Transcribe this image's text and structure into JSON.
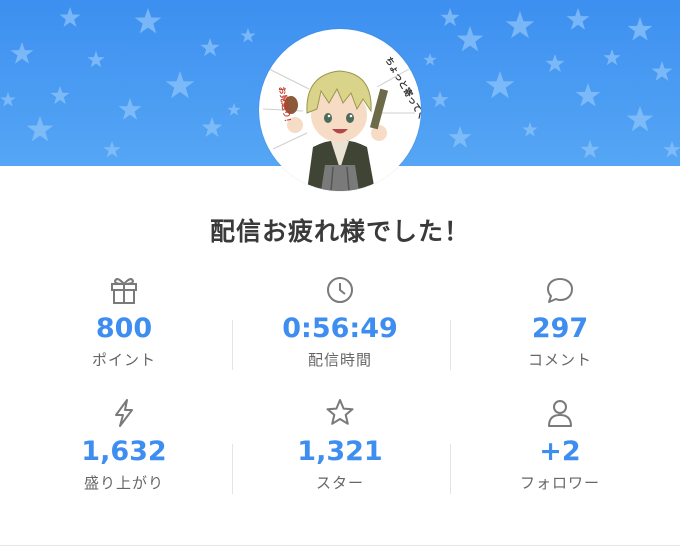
{
  "header": {
    "title": "配信お疲れ様でした！",
    "avatar_caption_right": "ちょっと寄ってく？",
    "avatar_caption_left": "お見送り！"
  },
  "stats": [
    {
      "icon": "gift-icon",
      "value": "800",
      "label": "ポイント"
    },
    {
      "icon": "clock-icon",
      "value": "0:56:49",
      "label": "配信時間"
    },
    {
      "icon": "comment-icon",
      "value": "297",
      "label": "コメント"
    },
    {
      "icon": "lightning-icon",
      "value": "1,632",
      "label": "盛り上がり"
    },
    {
      "icon": "star-icon",
      "value": "1,321",
      "label": "スター"
    },
    {
      "icon": "person-icon",
      "value": "+2",
      "label": "フォロワー"
    }
  ],
  "colors": {
    "banner": "#4b9df3",
    "accent": "#3d8ef0",
    "title_text": "#3a3a3a",
    "label_text": "#666666",
    "icon_stroke": "#7a7a7a"
  }
}
